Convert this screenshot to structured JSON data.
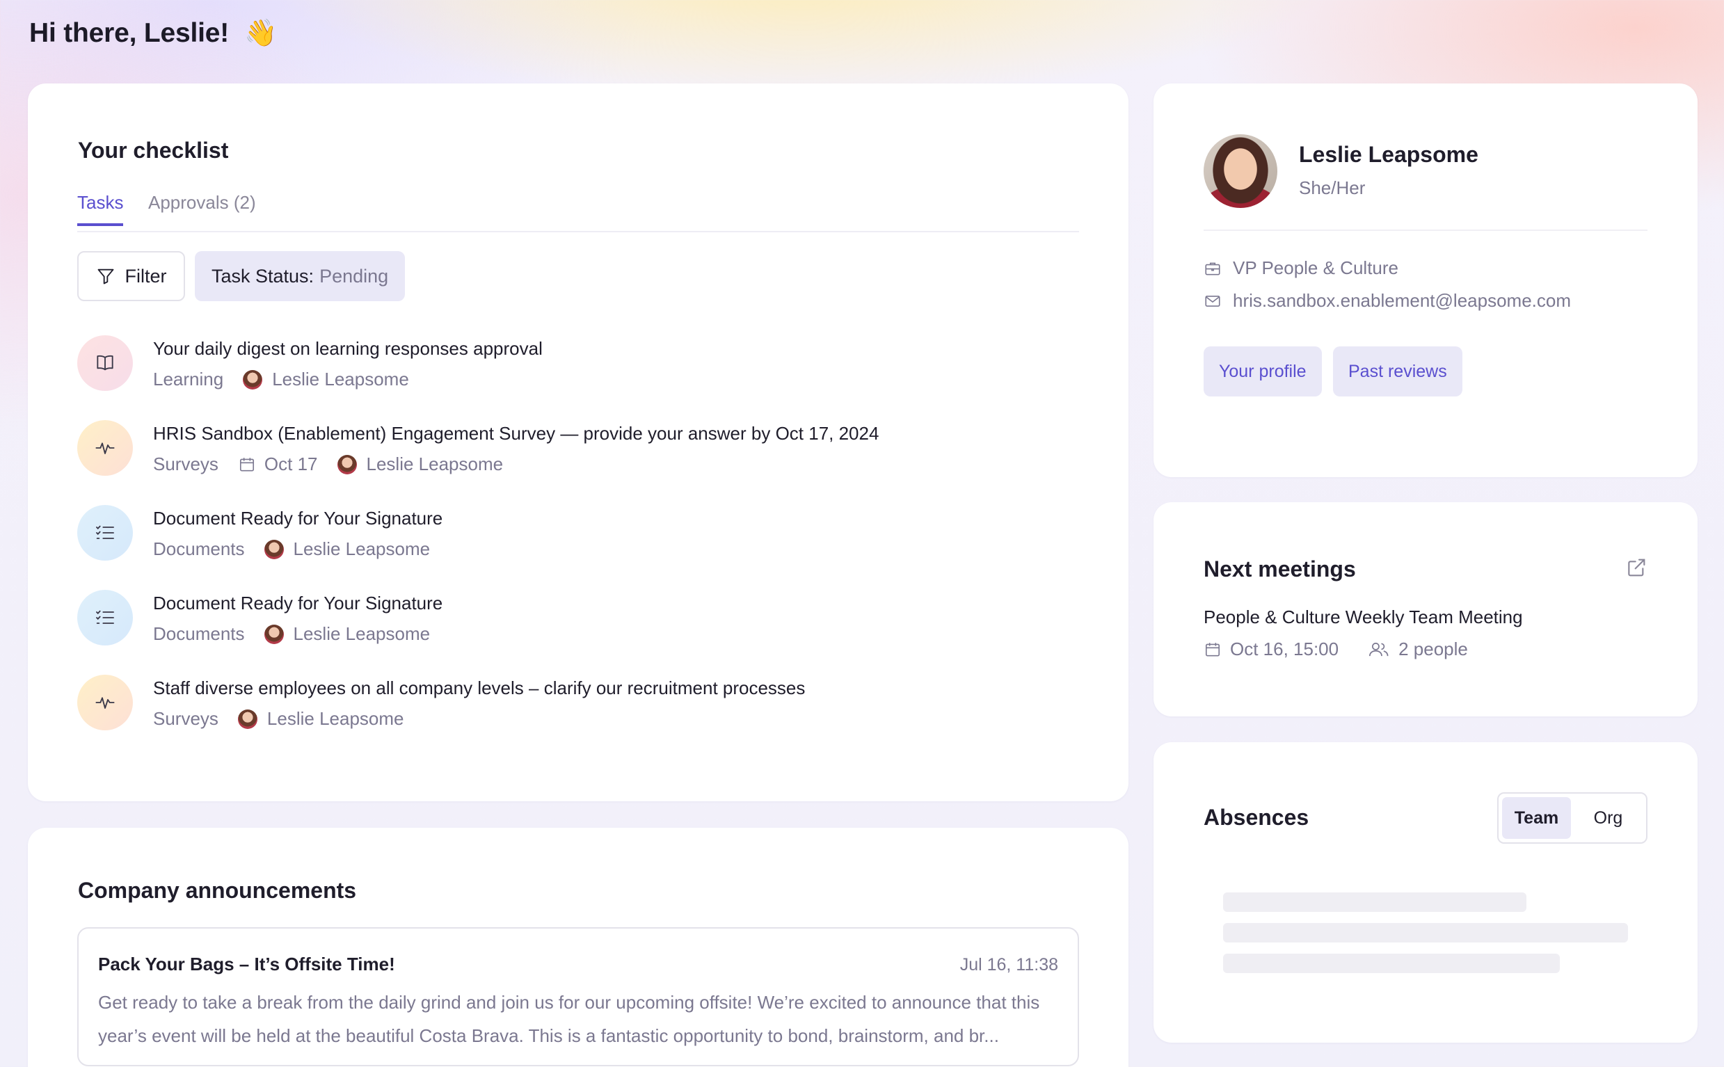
{
  "header": {
    "greeting": "Hi there, Leslie!",
    "emoji": "👋"
  },
  "checklist": {
    "title": "Your checklist",
    "tabs": [
      {
        "label": "Tasks",
        "active": true
      },
      {
        "label": "Approvals (2)",
        "active": false
      }
    ],
    "filter_label": "Filter",
    "status_filter": {
      "key": "Task Status:",
      "value": "Pending"
    },
    "tasks": [
      {
        "icon": "book-icon",
        "title": "Your daily digest on learning responses approval",
        "category": "Learning",
        "date": "",
        "assignee": "Leslie Leapsome"
      },
      {
        "icon": "pulse-icon",
        "title": "HRIS Sandbox (Enablement) Engagement Survey — provide your answer by Oct 17, 2024",
        "category": "Surveys",
        "date": "Oct 17",
        "assignee": "Leslie Leapsome"
      },
      {
        "icon": "checklist-icon",
        "title": "Document Ready for Your Signature",
        "category": "Documents",
        "date": "",
        "assignee": "Leslie Leapsome"
      },
      {
        "icon": "checklist-icon",
        "title": "Document Ready for Your Signature",
        "category": "Documents",
        "date": "",
        "assignee": "Leslie Leapsome"
      },
      {
        "icon": "pulse-icon",
        "title": "Staff diverse employees on all company levels – clarify our recruitment processes",
        "category": "Surveys",
        "date": "",
        "assignee": "Leslie Leapsome"
      }
    ]
  },
  "announcements": {
    "title": "Company announcements",
    "items": [
      {
        "title": "Pack Your Bags – It’s Offsite Time!",
        "date": "Jul 16, 11:38",
        "body": "Get ready to take a break from the daily grind and join us for our upcoming offsite! We’re excited to announce that this year’s event will be held at the beautiful Costa Brava. This is a fantastic opportunity to bond, brainstorm, and br..."
      }
    ]
  },
  "profile": {
    "name": "Leslie Leapsome",
    "pronouns": "She/Her",
    "role": "VP People & Culture",
    "email": "hris.sandbox.enablement@leapsome.com",
    "buttons": {
      "profile": "Your profile",
      "reviews": "Past reviews"
    }
  },
  "meetings": {
    "title": "Next meetings",
    "items": [
      {
        "title": "People & Culture Weekly Team Meeting",
        "datetime": "Oct 16, 15:00",
        "people": "2 people"
      }
    ]
  },
  "absences": {
    "title": "Absences",
    "toggle": [
      {
        "label": "Team",
        "active": true
      },
      {
        "label": "Org",
        "active": false
      }
    ]
  },
  "colors": {
    "accent": "#5a4fcf",
    "chip_bg": "#e9e8f7",
    "muted_text": "#7b7890"
  }
}
